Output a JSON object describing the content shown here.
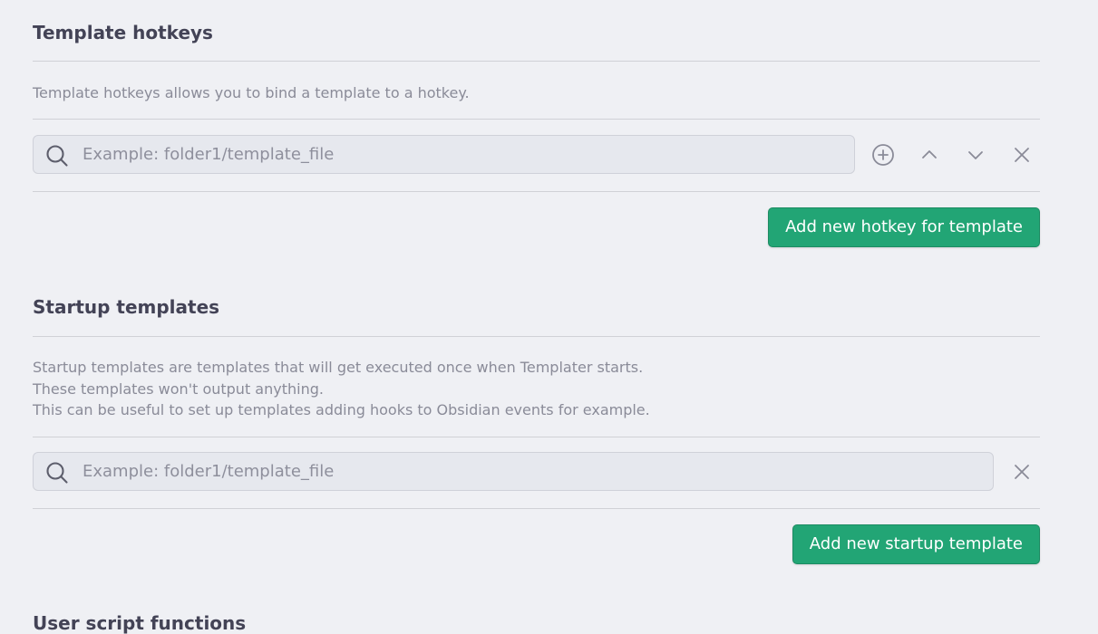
{
  "template_hotkeys": {
    "heading": "Template hotkeys",
    "description": "Template hotkeys allows you to bind a template to a hotkey.",
    "search": {
      "placeholder": "Example: folder1/template_file",
      "value": ""
    },
    "row_icons": [
      "plus-circle-icon",
      "chevron-up-icon",
      "chevron-down-icon",
      "close-icon"
    ],
    "add_button_label": "Add new hotkey for template"
  },
  "startup_templates": {
    "heading": "Startup templates",
    "description_lines": [
      "Startup templates are templates that will get executed once when Templater starts.",
      "These templates won't output anything.",
      "This can be useful to set up templates adding hooks to Obsidian events for example."
    ],
    "search": {
      "placeholder": "Example: folder1/template_file",
      "value": ""
    },
    "row_icons": [
      "close-icon"
    ],
    "add_button_label": "Add new startup template"
  },
  "user_script_functions": {
    "heading": "User script functions"
  },
  "colors": {
    "background": "#eff0f4",
    "accent_button": "#22a575",
    "input_background": "#e6e8ee",
    "muted_text": "#8a8b98",
    "heading_text": "#434356"
  }
}
